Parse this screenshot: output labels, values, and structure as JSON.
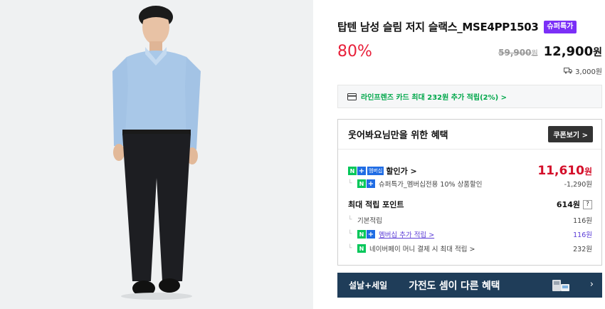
{
  "product": {
    "title": "탑텐 남성 슬림 저지 슬랙스_MSE4PP1503",
    "badge": "슈퍼특가",
    "discount_rate": "80%",
    "original_price": "59,900",
    "original_price_unit": "원",
    "sale_price": "12,900",
    "sale_price_unit": "원",
    "shipping_fee": "3,000원",
    "shipping_icon": "truck-icon"
  },
  "card_promo": {
    "icon": "credit-card-icon",
    "text": "라인프렌즈 카드 최대 232원 추가 적립(2%) >"
  },
  "benefit": {
    "title": "웃어봐요님만을 위한 혜택",
    "coupon_button": "쿠폰보기 >",
    "membership_badge": "멤버십",
    "discount_label": "할인가 >",
    "discount_price": "11,610",
    "discount_price_unit": "원",
    "discount_detail_label": "슈퍼특가_멤버십전용 10% 상품할인",
    "discount_detail_value": "-1,290원",
    "points_label": "최대 적립 포인트",
    "points_value": "614원",
    "points_help": "?",
    "basic_points_label": "기본적립",
    "basic_points_value": "116원",
    "membership_points_label": "멤버십 추가 적립 >",
    "membership_points_value": "116원",
    "naverpay_points_label": "네이버페이 머니 결제 시 최대 적립 >",
    "naverpay_points_value": "232원"
  },
  "banner": {
    "left_text": "설날+세일",
    "main_text": "가전도 셈이 다른 혜택",
    "arrow": "›"
  },
  "colors": {
    "discount_red": "#e8203a",
    "badge_purple": "#7b2ff7",
    "naver_green": "#03c75a",
    "membership_blue": "#1f6ce4",
    "banner_navy": "#1f3d59"
  }
}
